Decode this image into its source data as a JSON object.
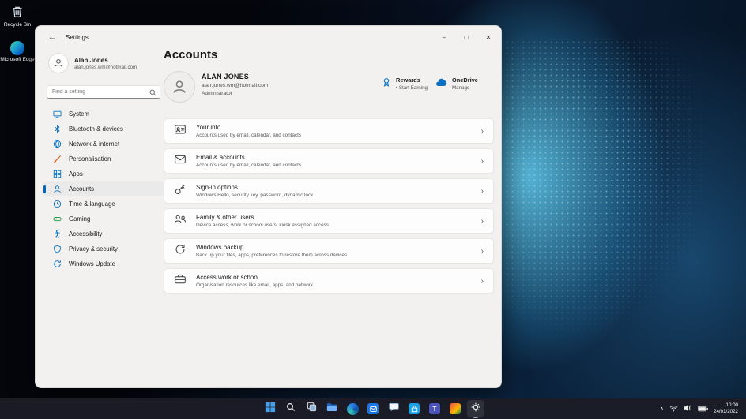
{
  "desktop": {
    "icons": [
      {
        "label": "Recycle Bin"
      },
      {
        "label": "Microsoft Edge"
      }
    ]
  },
  "window": {
    "titlebar": {
      "back": "←",
      "title": "Settings",
      "minimize": "–",
      "maximize": "□",
      "close": "✕"
    },
    "sidebar": {
      "user": {
        "name": "Alan Jones",
        "email": "alan.jones.wm@hotmail.com"
      },
      "search_placeholder": "Find a setting",
      "items": [
        {
          "label": "System"
        },
        {
          "label": "Bluetooth & devices"
        },
        {
          "label": "Network & internet"
        },
        {
          "label": "Personalisation"
        },
        {
          "label": "Apps"
        },
        {
          "label": "Accounts"
        },
        {
          "label": "Time & language"
        },
        {
          "label": "Gaming"
        },
        {
          "label": "Accessibility"
        },
        {
          "label": "Privacy & security"
        },
        {
          "label": "Windows Update"
        }
      ]
    },
    "main": {
      "page_title": "Accounts",
      "profile": {
        "name": "ALAN JONES",
        "email": "alan.jones.wm@hotmail.com",
        "role": "Administrator"
      },
      "rewards": {
        "title": "Rewards",
        "subtitle": "• Start Earning"
      },
      "onedrive": {
        "title": "OneDrive",
        "subtitle": "Manage"
      },
      "chevron": "›",
      "cards": [
        {
          "title": "Your info",
          "subtitle": "Accounts used by email, calendar, and contacts"
        },
        {
          "title": "Email & accounts",
          "subtitle": "Accounts used by email, calendar, and contacts"
        },
        {
          "title": "Sign-in options",
          "subtitle": "Windows Hello, security key, password, dynamic lock"
        },
        {
          "title": "Family & other users",
          "subtitle": "Device access, work or school users, kiosk assigned access"
        },
        {
          "title": "Windows backup",
          "subtitle": "Back up your files, apps, preferences to restore them across devices"
        },
        {
          "title": "Access work or school",
          "subtitle": "Organisation resources like email, apps, and network"
        }
      ]
    }
  },
  "taskbar": {
    "tray": {
      "chevron": "∧",
      "time": "10:00",
      "date": "24/01/2022"
    }
  }
}
